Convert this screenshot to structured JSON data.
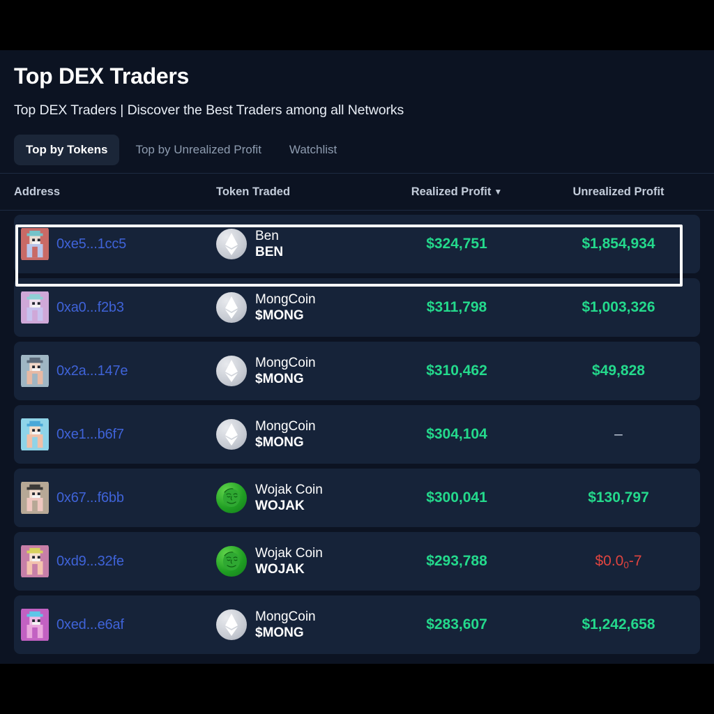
{
  "page": {
    "title": "Top DEX Traders",
    "subtitle": "Top DEX Traders | Discover the Best Traders among all Networks"
  },
  "tabs": [
    {
      "label": "Top by Tokens",
      "active": true
    },
    {
      "label": "Top by Unrealized Profit",
      "active": false
    },
    {
      "label": "Watchlist",
      "active": false
    }
  ],
  "table": {
    "columns": [
      {
        "key": "address",
        "label": "Address"
      },
      {
        "key": "token",
        "label": "Token Traded"
      },
      {
        "key": "realized",
        "label": "Realized Profit",
        "sorted": true,
        "sort_caret": "▼"
      },
      {
        "key": "unrealized",
        "label": "Unrealized Profit"
      }
    ],
    "rows": [
      {
        "address": "0xe5...1cc5",
        "avatar_colors": [
          "#c96a66",
          "#eaddd2",
          "#74c3c9",
          "#b9c6ea"
        ],
        "token_name": "Ben",
        "token_symbol": "BEN",
        "token_icon": "eth-diamond-icon",
        "realized": "$324,751",
        "unrealized": "$1,854,934",
        "unrealized_kind": "positive",
        "highlighted": true
      },
      {
        "address": "0xa0...f2b3",
        "avatar_colors": [
          "#cfa8d8",
          "#f0e3ef",
          "#8fd0d6",
          "#c7c2ee"
        ],
        "token_name": "MongCoin",
        "token_symbol": "$MONG",
        "token_icon": "eth-diamond-icon",
        "realized": "$311,798",
        "unrealized": "$1,003,326",
        "unrealized_kind": "positive",
        "highlighted": false
      },
      {
        "address": "0x2a...147e",
        "avatar_colors": [
          "#9fb6c4",
          "#f2d8c9",
          "#5c6a7a",
          "#e7b9a4"
        ],
        "token_name": "MongCoin",
        "token_symbol": "$MONG",
        "token_icon": "eth-diamond-icon",
        "realized": "$310,462",
        "unrealized": "$49,828",
        "unrealized_kind": "positive",
        "highlighted": false
      },
      {
        "address": "0xe1...b6f7",
        "avatar_colors": [
          "#8fd4e8",
          "#f6ddc8",
          "#4aa8d8",
          "#f0c0a8"
        ],
        "token_name": "MongCoin",
        "token_symbol": "$MONG",
        "token_icon": "eth-diamond-icon",
        "realized": "$304,104",
        "unrealized": "–",
        "unrealized_kind": "none",
        "highlighted": false
      },
      {
        "address": "0x67...f6bb",
        "avatar_colors": [
          "#b7a896",
          "#f4dfd3",
          "#3c3a38",
          "#efc7c0"
        ],
        "token_name": "Wojak Coin",
        "token_symbol": "WOJAK",
        "token_icon": "wojak-face-icon",
        "realized": "$300,041",
        "unrealized": "$130,797",
        "unrealized_kind": "positive",
        "highlighted": false
      },
      {
        "address": "0xd9...32fe",
        "avatar_colors": [
          "#c77fa8",
          "#f7e2d2",
          "#d8d25e",
          "#f3c3ae"
        ],
        "token_name": "Wojak Coin",
        "token_symbol": "WOJAK",
        "token_icon": "wojak-face-icon",
        "realized": "$293,788",
        "unrealized": "$0.0",
        "unrealized_sub": "0",
        "unrealized_tail": "-7",
        "unrealized_kind": "negative",
        "highlighted": false
      },
      {
        "address": "0xed...e6af",
        "avatar_colors": [
          "#c261c2",
          "#f0b9e6",
          "#5ec6e8",
          "#e9a6dd"
        ],
        "token_name": "MongCoin",
        "token_symbol": "$MONG",
        "token_icon": "eth-diamond-icon",
        "realized": "$283,607",
        "unrealized": "$1,242,658",
        "unrealized_kind": "positive",
        "highlighted": false
      }
    ]
  },
  "colors": {
    "page_bg": "#0c1322",
    "row_bg": "#162339",
    "accent_green": "#24d98c",
    "accent_red": "#e0443f",
    "link_blue": "#3f63d8",
    "highlight_border": "#ffffff"
  }
}
